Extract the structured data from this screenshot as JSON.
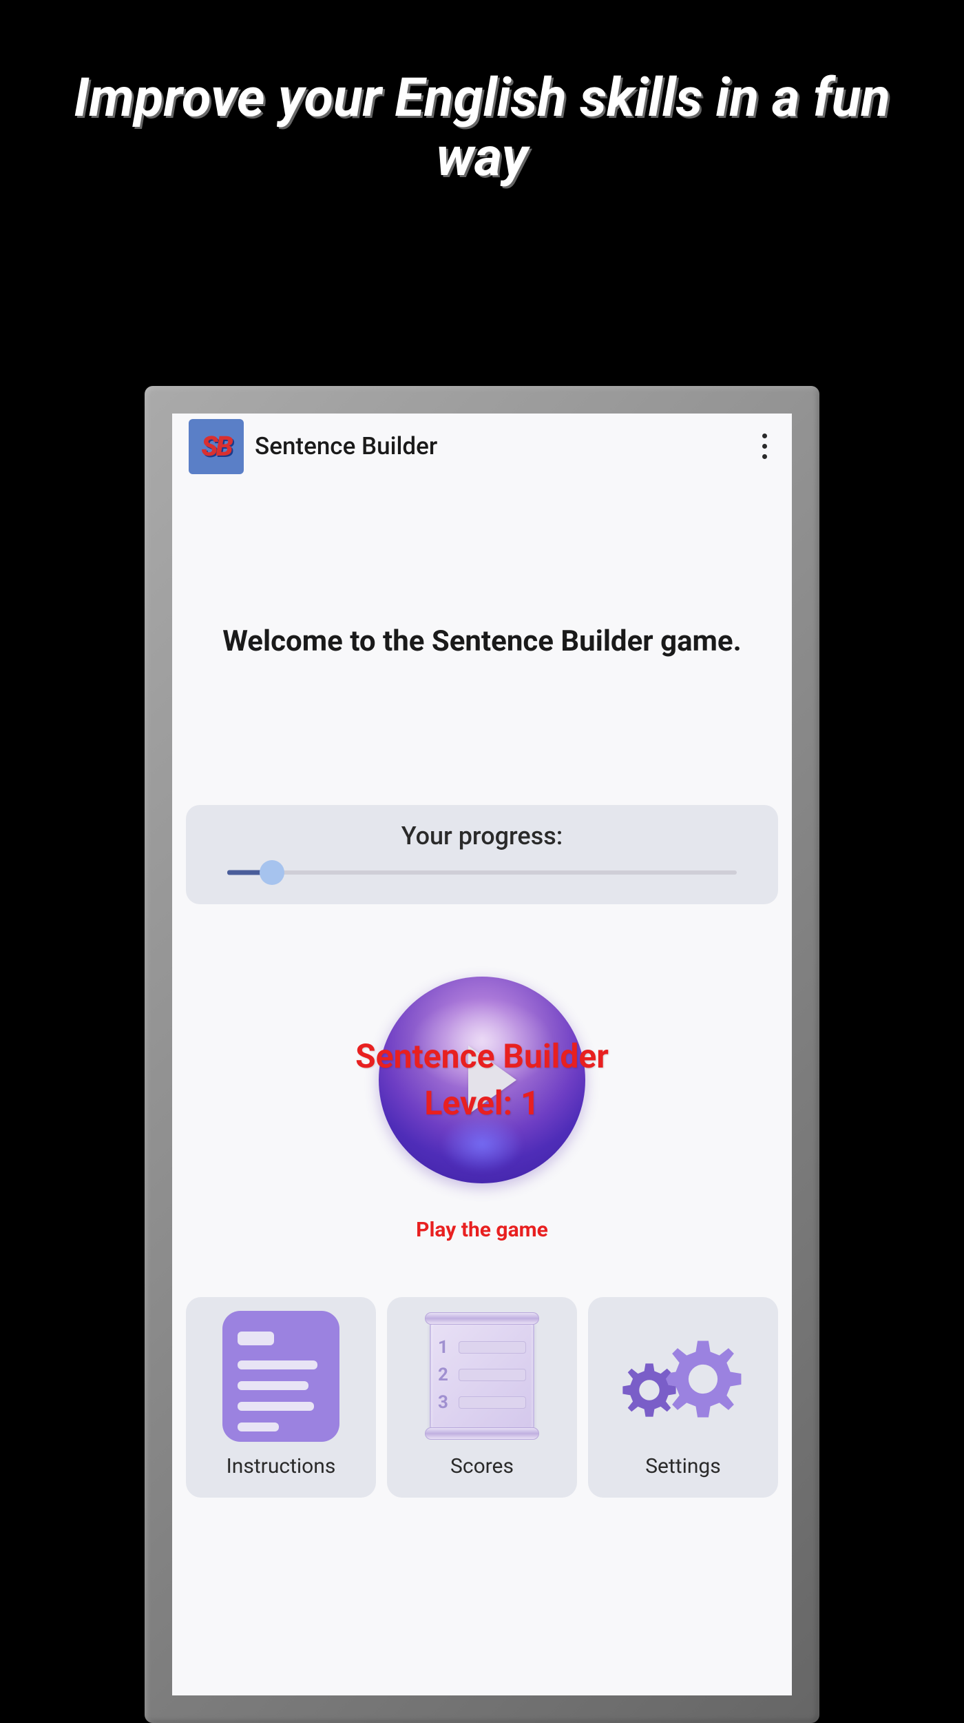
{
  "promo": {
    "headline": "Improve your English skills in a fun way"
  },
  "appbar": {
    "icon_text": "SB",
    "title": "Sentence Builder"
  },
  "welcome": "Welcome to the Sentence Builder game.",
  "progress": {
    "label": "Your progress:",
    "percent": 8
  },
  "play": {
    "title_line1": "Sentence Builder",
    "title_line2": "Level: 1",
    "caption": "Play the game"
  },
  "nav": {
    "instructions": "Instructions",
    "scores": "Scores",
    "settings": "Settings"
  },
  "colors": {
    "accent_red": "#e82020",
    "accent_purple": "#9b82e0",
    "slider_fill": "#4a5d9a"
  }
}
